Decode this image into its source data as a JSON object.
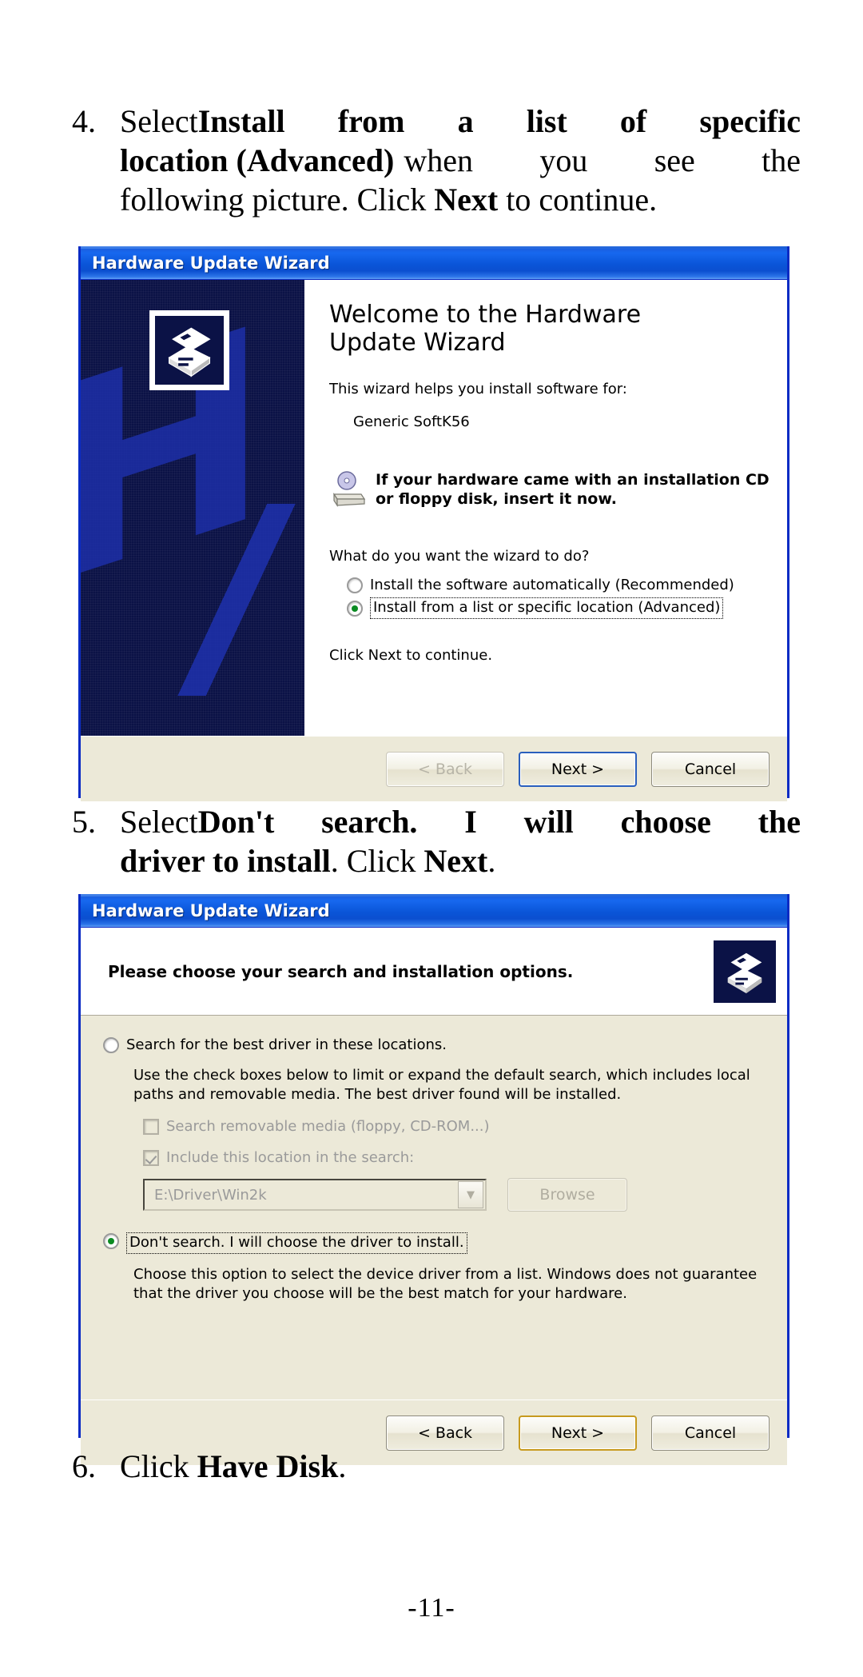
{
  "document": {
    "page_number": "-11-"
  },
  "steps": [
    {
      "number": "4.",
      "line1_a": "Select ",
      "line1_b": "Install from a list of specific",
      "line2_b": "location (Advanced)",
      "line2_a": " when you see the",
      "line3_a": "following picture. Click ",
      "line3_b": "Next",
      "line3_c": " to continue."
    },
    {
      "number": "5.",
      "line1_a": "Select ",
      "line1_b": "Don't search. I will choose the",
      "line2_b": "driver to install",
      "line2_a": ". Click ",
      "line2_c": "Next",
      "line2_d": "."
    },
    {
      "number": "6.",
      "line1_a": "Click ",
      "line1_b": "Have Disk",
      "line1_c": "."
    }
  ],
  "dialog1": {
    "title": "Hardware Update Wizard",
    "banner_icon_name": "hardware-device-icon",
    "heading": "Welcome to the Hardware Update Wizard",
    "intro": "This wizard helps you install software for:",
    "device_name": "Generic SoftK56",
    "cd_notice_line1": "If your hardware came with an installation CD",
    "cd_notice_line2": "or floppy disk, insert it now.",
    "question": "What do you want the wizard to do?",
    "options": [
      {
        "label": "Install the software automatically (Recommended)",
        "selected": false,
        "focused": false
      },
      {
        "label": "Install from a list or specific location (Advanced)",
        "selected": true,
        "focused": true
      }
    ],
    "footer_hint": "Click Next to continue.",
    "buttons": [
      {
        "label": "< Back",
        "state": "disabled"
      },
      {
        "label": "Next >",
        "state": "default"
      },
      {
        "label": "Cancel",
        "state": "normal"
      }
    ]
  },
  "dialog2": {
    "title": "Hardware Update Wizard",
    "header_text": "Please choose your search and installation options.",
    "header_icon_name": "hardware-device-icon",
    "option_search": {
      "label": "Search for the best driver in these locations.",
      "selected": false,
      "description": "Use the check boxes below to limit or expand the default search, which includes local paths and removable media. The best driver found will be installed.",
      "checkbox_removable": {
        "label": "Search removable media (floppy, CD-ROM...)",
        "checked": false,
        "disabled": true
      },
      "checkbox_location": {
        "label": "Include this location in the search:",
        "checked": true,
        "disabled": true
      },
      "location_value": "E:\\Driver\\Win2k",
      "browse_label": "Browse"
    },
    "option_dontsearch": {
      "label": "Don't search. I will choose the driver to install.",
      "selected": true,
      "focused": true,
      "description": "Choose this option to select the device driver from a list.  Windows does not guarantee that the driver you choose will be the best match for your hardware."
    },
    "buttons": [
      {
        "label": "< Back",
        "state": "normal"
      },
      {
        "label": "Next >",
        "state": "default-gold"
      },
      {
        "label": "Cancel",
        "state": "normal"
      }
    ]
  },
  "colors": {
    "titlebar_blue": "#0a55d8",
    "window_border": "#0a2bc4",
    "dialog_face": "#ece9d8",
    "banner_dark": "#0b1246",
    "banner_watermark": "#1d2fa8",
    "radio_green": "#0b8b22",
    "default_button_border": "#2a5fbd",
    "gold_button_border": "#c79a1f"
  }
}
